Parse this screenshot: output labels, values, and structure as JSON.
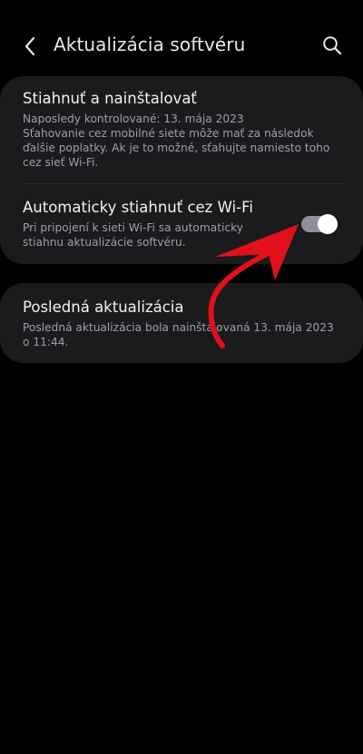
{
  "header": {
    "title": "Aktualizácia softvéru",
    "back_icon": "chevron-left-icon",
    "search_icon": "search-icon"
  },
  "download_install": {
    "title": "Stiahnuť a nainštalovať",
    "desc_line1": "Naposledy kontrolované: 13. mája 2023",
    "desc_line2": "Sťahovanie cez mobilné siete môže mať za následok",
    "desc_line3": "ďalšie poplatky. Ak je to možné, sťahujte namiesto toho",
    "desc_line4": "cez sieť Wi-Fi."
  },
  "auto_download": {
    "title": "Automaticky stiahnuť cez Wi-Fi",
    "desc_line1": "Pri pripojení k sieti Wi-Fi sa automaticky",
    "desc_line2": "stiahnu aktualizácie softvéru.",
    "toggle_on": true
  },
  "last_update": {
    "title": "Posledná aktualizácia",
    "desc_line1": "Posledná aktualizácia bola nainštalovaná 13. mája 2023",
    "desc_line2": "o 11:44."
  },
  "colors": {
    "background": "#000000",
    "card": "#1b1b1e",
    "annotation_arrow": "#e0111c"
  }
}
